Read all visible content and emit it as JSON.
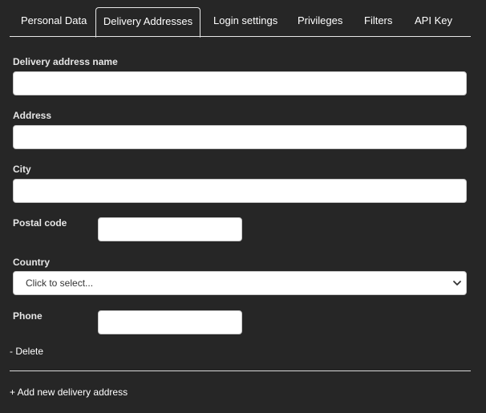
{
  "tabs": [
    {
      "label": "Personal Data"
    },
    {
      "label": "Delivery Addresses"
    },
    {
      "label": "Login settings"
    },
    {
      "label": "Privileges"
    },
    {
      "label": "Filters"
    },
    {
      "label": "API Key"
    }
  ],
  "active_tab": "Delivery Addresses",
  "form": {
    "delivery_address_name": {
      "label": "Delivery address name",
      "value": ""
    },
    "address": {
      "label": "Address",
      "value": ""
    },
    "city": {
      "label": "City",
      "value": ""
    },
    "postal_code": {
      "label": "Postal code",
      "value": ""
    },
    "country": {
      "label": "Country",
      "selected": "Click to select..."
    },
    "phone": {
      "label": "Phone",
      "value": ""
    }
  },
  "actions": {
    "delete_label": "- Delete",
    "add_label": "+ Add new delivery address"
  },
  "colors": {
    "background": "#262626",
    "text": "#ffffff",
    "input_background": "#ffffff",
    "border": "#e6e6e6"
  },
  "icons": {
    "country_select": "chevron-down-icon"
  }
}
